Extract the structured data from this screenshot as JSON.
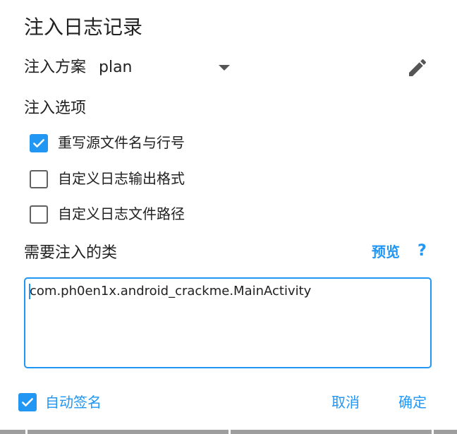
{
  "dialog": {
    "title": "注入日志记录"
  },
  "plan": {
    "label": "注入方案",
    "value": "plan"
  },
  "icons": {
    "dropdown": "chevron-down-icon",
    "edit": "pencil-icon",
    "checkbox_checked": "checkmark-icon"
  },
  "options": {
    "label": "注入选项",
    "items": [
      {
        "label": "重写源文件名与行号",
        "checked": true
      },
      {
        "label": "自定义日志输出格式",
        "checked": false
      },
      {
        "label": "自定义日志文件路径",
        "checked": false
      }
    ]
  },
  "classes": {
    "label": "需要注入的类",
    "preview_label": "预览",
    "help_label": "?",
    "value": "com.ph0en1x.android_crackme.MainActivity"
  },
  "footer": {
    "autosign_label": "自动签名",
    "autosign_checked": true,
    "cancel_label": "取消",
    "ok_label": "确定"
  },
  "colors": {
    "accent": "#2196f3",
    "text": "#212121",
    "checkbox_border": "#616161"
  }
}
